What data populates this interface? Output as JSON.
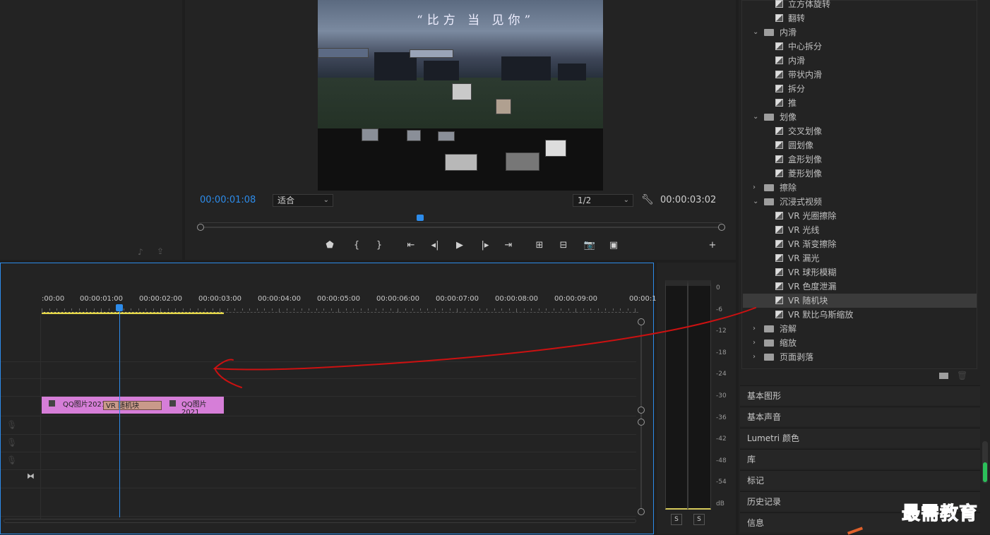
{
  "monitor": {
    "timecode_current": "00:00:01:08",
    "fit_select": "适合",
    "resolution_select": "1/2",
    "timecode_duration": "00:00:03:02",
    "video_caption_fragments": [
      "“比方",
      "当",
      "见你”"
    ],
    "controls": [
      {
        "name": "add-marker-button",
        "glyph": "⬟"
      },
      {
        "name": "mark-in-button",
        "glyph": "{"
      },
      {
        "name": "mark-out-button",
        "glyph": "}"
      },
      {
        "name": "go-to-in-button",
        "glyph": "⇤"
      },
      {
        "name": "step-back-button",
        "glyph": "◂|"
      },
      {
        "name": "play-button",
        "glyph": "▶"
      },
      {
        "name": "step-forward-button",
        "glyph": "|▸"
      },
      {
        "name": "go-to-out-button",
        "glyph": "⇥"
      },
      {
        "name": "insert-button",
        "glyph": "⊞"
      },
      {
        "name": "overwrite-button",
        "glyph": "⊟"
      },
      {
        "name": "export-frame-button",
        "glyph": "📷"
      },
      {
        "name": "comparison-view-button",
        "glyph": "▣"
      },
      {
        "name": "button-editor-button",
        "glyph": "+"
      }
    ]
  },
  "timeline": {
    "ruler": [
      ":00:00",
      "00:00:01:00",
      "00:00:02:00",
      "00:00:03:00",
      "00:00:04:00",
      "00:00:05:00",
      "00:00:06:00",
      "00:00:07:00",
      "00:00:08:00",
      "00:00:09:00",
      "00:00:1"
    ],
    "clip_left_label": "QQ图片2021",
    "clip_right_label": "QQ图片2021",
    "transition_label": "VR 随机块",
    "playhead_value": "00:00:01:08"
  },
  "meter": {
    "db_labels": [
      "0",
      "-6",
      "-12",
      "-18",
      "-24",
      "-30",
      "-36",
      "-42",
      "-48",
      "-54",
      "dB"
    ],
    "solo_left": "S",
    "solo_right": "S"
  },
  "effects": {
    "rows": [
      {
        "kind": "item",
        "label": "立方体旋转"
      },
      {
        "kind": "item",
        "label": "翻转"
      },
      {
        "kind": "folder-open",
        "label": "内滑"
      },
      {
        "kind": "item",
        "label": "中心拆分"
      },
      {
        "kind": "item",
        "label": "内滑"
      },
      {
        "kind": "item",
        "label": "带状内滑"
      },
      {
        "kind": "item",
        "label": "拆分"
      },
      {
        "kind": "item",
        "label": "推"
      },
      {
        "kind": "folder-open",
        "label": "划像"
      },
      {
        "kind": "item",
        "label": "交叉划像"
      },
      {
        "kind": "item",
        "label": "圆划像"
      },
      {
        "kind": "item",
        "label": "盒形划像"
      },
      {
        "kind": "item",
        "label": "菱形划像"
      },
      {
        "kind": "folder-closed",
        "label": "擦除"
      },
      {
        "kind": "folder-open",
        "label": "沉浸式视频"
      },
      {
        "kind": "item",
        "label": "VR 光圈擦除"
      },
      {
        "kind": "item",
        "label": "VR 光线"
      },
      {
        "kind": "item",
        "label": "VR 渐变擦除"
      },
      {
        "kind": "item",
        "label": "VR 漏光"
      },
      {
        "kind": "item",
        "label": "VR 球形模糊"
      },
      {
        "kind": "item",
        "label": "VR 色度泄漏"
      },
      {
        "kind": "item",
        "label": "VR 随机块",
        "selected": true
      },
      {
        "kind": "item",
        "label": "VR 默比乌斯缩放"
      },
      {
        "kind": "folder-closed",
        "label": "溶解"
      },
      {
        "kind": "folder-closed",
        "label": "缩放"
      },
      {
        "kind": "folder-closed",
        "label": "页面剥落"
      }
    ]
  },
  "panels": [
    "基本图形",
    "基本声音",
    "Lumetri 颜色",
    "库",
    "标记",
    "历史记录",
    "信息"
  ],
  "watermark": "最需教育",
  "colors": {
    "accent": "#2d8ceb",
    "clip": "#d67ed8",
    "transition": "#c99a8a",
    "annotation": "#cc1111"
  }
}
